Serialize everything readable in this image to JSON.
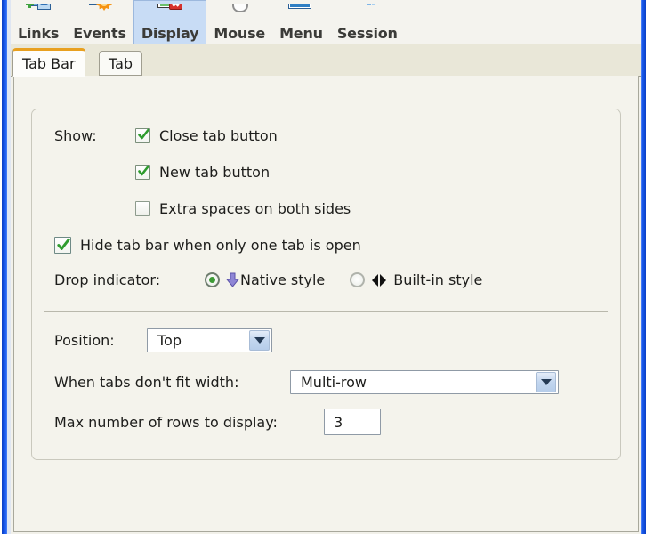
{
  "window": {
    "border_color": "#1451e0"
  },
  "toolbar": {
    "items": [
      {
        "label": "Links",
        "icon": "links-icon",
        "selected": false
      },
      {
        "label": "Events",
        "icon": "events-icon",
        "selected": false
      },
      {
        "label": "Display",
        "icon": "display-icon",
        "selected": true
      },
      {
        "label": "Mouse",
        "icon": "mouse-icon",
        "selected": false
      },
      {
        "label": "Menu",
        "icon": "menu-icon",
        "selected": false
      },
      {
        "label": "Session",
        "icon": "session-icon",
        "selected": false
      }
    ]
  },
  "tabs": {
    "active_index": 0,
    "items": [
      {
        "label": "Tab Bar"
      },
      {
        "label": "Tab"
      }
    ],
    "active_accent": "#e8a020"
  },
  "settings": {
    "show_label": "Show:",
    "checkboxes": [
      {
        "label": "Close tab button",
        "checked": true
      },
      {
        "label": "New tab button",
        "checked": true
      },
      {
        "label": "Extra spaces on both sides",
        "checked": false
      }
    ],
    "hide_tab_bar": {
      "label": "Hide tab bar when only one tab is open",
      "checked": true
    },
    "drop_indicator": {
      "label": "Drop indicator:",
      "options": [
        {
          "label": "Native style",
          "selected": true,
          "icon": "arrow-down-icon"
        },
        {
          "label": "Built-in style",
          "selected": false,
          "icon": "arrows-left-right-icon"
        }
      ]
    },
    "position": {
      "label": "Position:",
      "value": "Top"
    },
    "overflow": {
      "label": "When tabs don't fit width:",
      "value": "Multi-row"
    },
    "max_rows": {
      "label": "Max number of rows to display:",
      "value": "3"
    }
  }
}
